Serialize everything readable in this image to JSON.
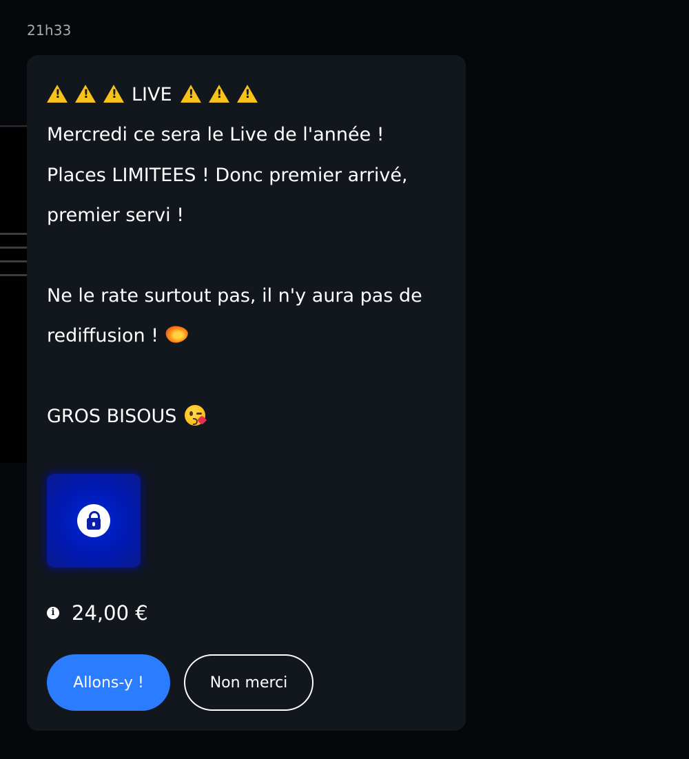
{
  "header": {
    "timestamp": "21h33"
  },
  "message": {
    "headline": "LIVE",
    "lines": [
      "Mercredi ce sera le Live de l'année !",
      "Places LIMITEES ! Donc premier arrivé,",
      "premier servi !",
      "",
      "Ne le rate surtout pas, il n'y aura pas de",
      "rediffusion !",
      "",
      "GROS BISOUS"
    ],
    "icons": {
      "headline_before": [
        "warning-icon",
        "warning-icon",
        "warning-icon"
      ],
      "headline_after": [
        "warning-icon",
        "warning-icon",
        "warning-icon"
      ],
      "line_6_suffix": "fire-icon",
      "line_8_suffix": "kissing-face-icon"
    }
  },
  "media": {
    "locked": true,
    "icon": "lock-icon"
  },
  "price": {
    "icon": "info-icon",
    "value": "24,00 €"
  },
  "actions": {
    "accept_label": "Allons-y !",
    "decline_label": "Non merci"
  },
  "colors": {
    "page_background": "#05070b",
    "card_background": "#12161d",
    "timestamp_text": "#a7aab0",
    "primary_button": "#2b7cff",
    "warning": "#f7c21a",
    "locked_media": "#0027d8"
  }
}
